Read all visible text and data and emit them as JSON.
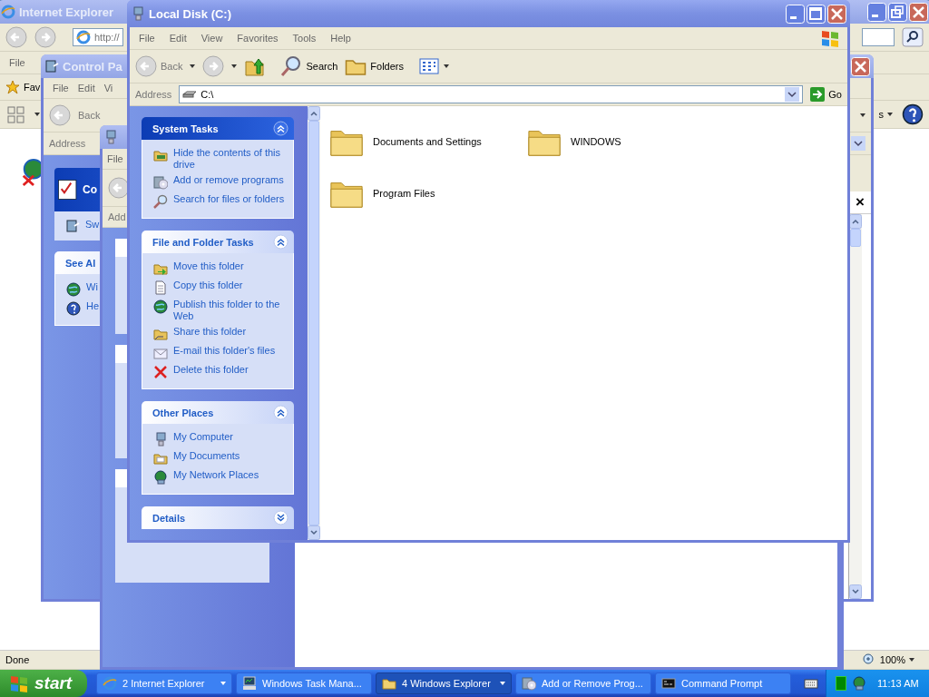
{
  "ie_window": {
    "title": "Internet Explorer",
    "active": false,
    "address": "http://",
    "menu": [
      "File"
    ],
    "links_label": "Fav",
    "toolbar_text": "s",
    "status": "Done",
    "zoom": "100%"
  },
  "control_panel": {
    "title": "Control Pa",
    "active": false,
    "menu": [
      "File",
      "Edit",
      "Vi"
    ],
    "back": "Back",
    "address_label": "Address",
    "header": "Co",
    "task": "Sw",
    "see_also": {
      "title": "See Al",
      "items": [
        {
          "label": "Wi",
          "kind": "globe"
        },
        {
          "label": "He",
          "kind": "help"
        }
      ]
    },
    "pane_close": "×"
  },
  "add_remove": {
    "active": false,
    "menu": [
      "File"
    ],
    "address_label": "Add"
  },
  "explorer": {
    "title": "Local Disk (C:)",
    "active": true,
    "menu": [
      "File",
      "Edit",
      "View",
      "Favorites",
      "Tools",
      "Help"
    ],
    "back": "Back",
    "search": "Search",
    "folders": "Folders",
    "address_label": "Address",
    "address": "C:\\",
    "go": "Go",
    "panels": [
      {
        "title": "System Tasks",
        "kind": "special",
        "expanded": true,
        "items": [
          {
            "label": "Hide the contents of this drive",
            "kind": "drive"
          },
          {
            "label": "Add or remove programs",
            "kind": "programs"
          },
          {
            "label": "Search for files or folders",
            "kind": "search"
          }
        ]
      },
      {
        "title": "File and Folder Tasks",
        "kind": "normal",
        "expanded": true,
        "items": [
          {
            "label": "Move this folder",
            "kind": "move"
          },
          {
            "label": "Copy this folder",
            "kind": "copy"
          },
          {
            "label": "Publish this folder to the Web",
            "kind": "globe"
          },
          {
            "label": "Share this folder",
            "kind": "share"
          },
          {
            "label": "E-mail this folder's files",
            "kind": "email"
          },
          {
            "label": "Delete this folder",
            "kind": "delete"
          }
        ]
      },
      {
        "title": "Other Places",
        "kind": "normal",
        "expanded": true,
        "items": [
          {
            "label": "My Computer",
            "kind": "computer"
          },
          {
            "label": "My Documents",
            "kind": "documents"
          },
          {
            "label": "My Network Places",
            "kind": "network"
          }
        ]
      },
      {
        "title": "Details",
        "kind": "normal",
        "expanded": false
      }
    ],
    "files": [
      {
        "name": "Documents and Settings"
      },
      {
        "name": "WINDOWS"
      },
      {
        "name": "Program Files"
      }
    ]
  },
  "taskbar": {
    "start": "start",
    "buttons": [
      {
        "label": "2 Internet Explorer",
        "kind": "ie",
        "group": true,
        "selected": false
      },
      {
        "label": "Windows Task Mana...",
        "kind": "monitor",
        "group": false,
        "selected": false
      },
      {
        "label": "4 Windows Explorer",
        "kind": "folder",
        "group": true,
        "selected": true
      },
      {
        "label": "Add or Remove Prog...",
        "kind": "programs",
        "group": false,
        "selected": false
      },
      {
        "label": "Command Prompt",
        "kind": "cmd",
        "group": false,
        "selected": false
      }
    ],
    "clock": "11:13 AM"
  }
}
